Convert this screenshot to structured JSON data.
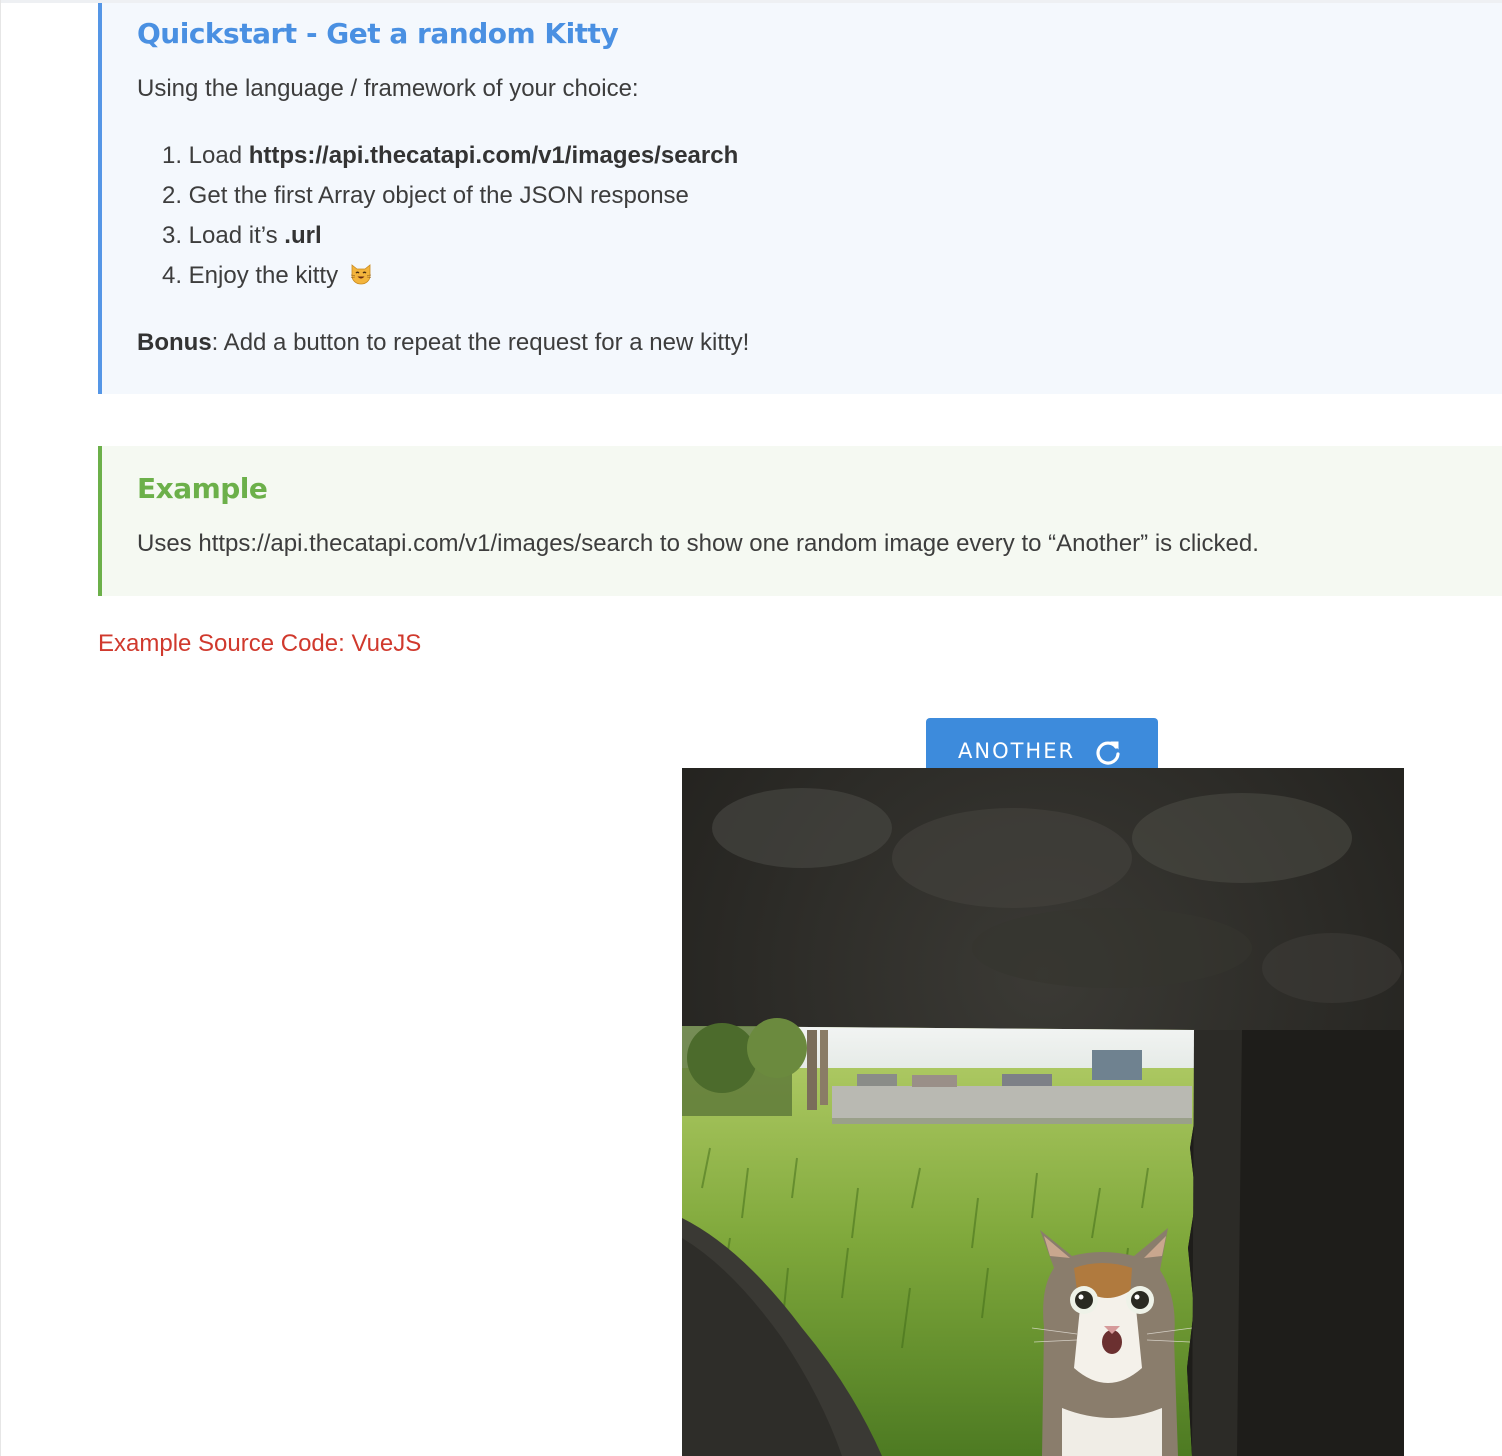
{
  "quickstart": {
    "title": "Quickstart - Get a random Kitty",
    "intro": "Using the language / framework of your choice:",
    "steps": [
      {
        "num": "1.",
        "text": "Load ",
        "bold": "https://api.thecatapi.com/v1/images/search"
      },
      {
        "num": "2.",
        "text": "Get the first Array object of the JSON response"
      },
      {
        "num": "3.",
        "text": "Load it’s ",
        "bold": ".url"
      },
      {
        "num": "4.",
        "text": "Enjoy the kitty",
        "emoji": "smiling-cat-emoji"
      }
    ],
    "bonus_label": "Bonus",
    "bonus_text": ": Add a button to repeat the request for a new kitty!"
  },
  "example": {
    "title": "Example",
    "description": "Uses https://api.thecatapi.com/v1/images/search to show one random image every to “Another” is clicked.",
    "source_link": "Example Source Code: VueJS"
  },
  "viewer": {
    "button_label": "ANOTHER",
    "button_icon": "refresh-icon"
  },
  "colors": {
    "info_accent": "#5596e6",
    "info_title": "#4a90e2",
    "info_bg": "#f4f8fd",
    "success_accent": "#6cb04a",
    "success_bg": "#f5f9f2",
    "link": "#d0392d",
    "button": "#3d8bdc"
  }
}
